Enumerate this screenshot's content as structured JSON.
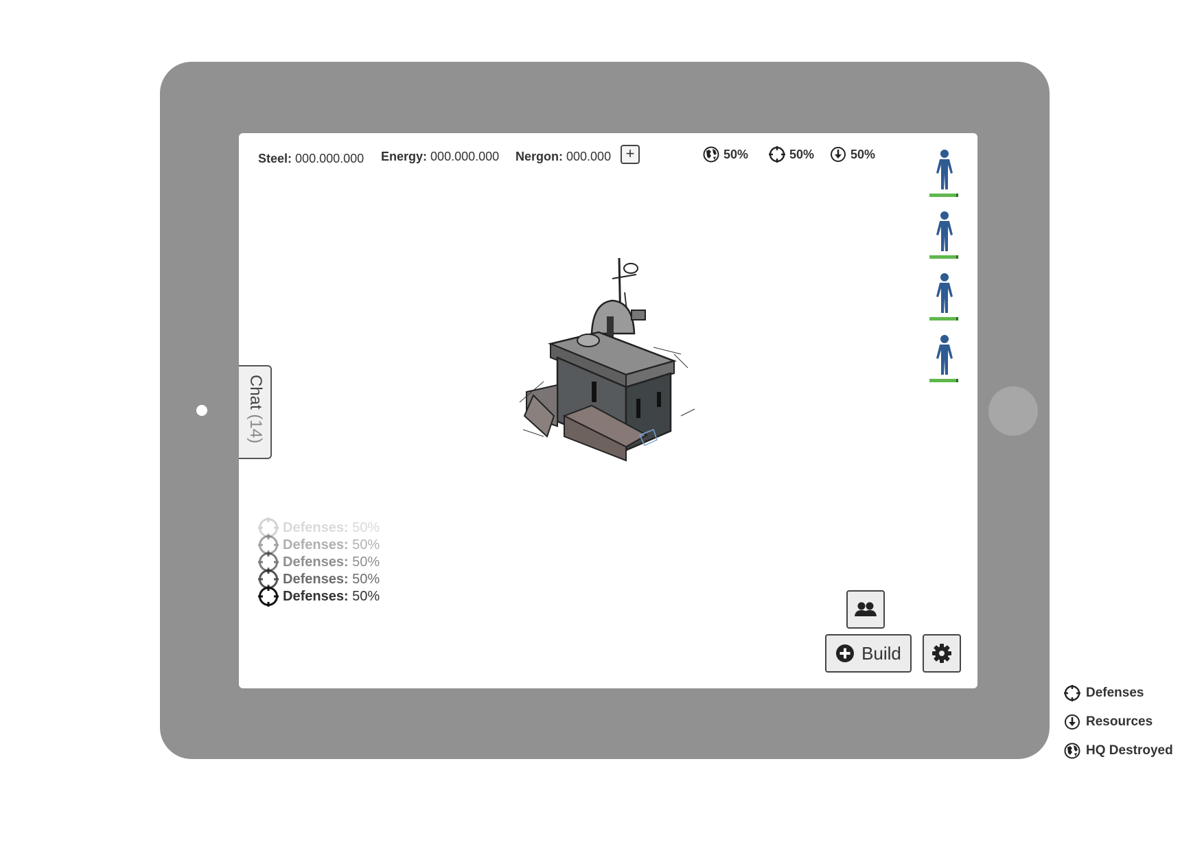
{
  "resources": {
    "steel_label": "Steel:",
    "steel_value": "000.000.000",
    "energy_label": "Energy:",
    "energy_value": "000.000.000",
    "nergon_label": "Nergon:",
    "nergon_value": "000.000",
    "add_label": "+"
  },
  "stats": {
    "hq_destroyed": "50%",
    "defenses": "50%",
    "resources": "50%"
  },
  "players": [
    {
      "icon": "person-icon",
      "health": 1.0
    },
    {
      "icon": "person-icon",
      "health": 1.0
    },
    {
      "icon": "person-icon",
      "health": 1.0
    },
    {
      "icon": "person-icon",
      "health": 1.0
    }
  ],
  "chat": {
    "label": "Chat",
    "count": "(14)"
  },
  "log": [
    {
      "label": "Defenses:",
      "value": "50%"
    },
    {
      "label": "Defenses:",
      "value": "50%"
    },
    {
      "label": "Defenses:",
      "value": "50%"
    },
    {
      "label": "Defenses:",
      "value": "50%"
    },
    {
      "label": "Defenses:",
      "value": "50%"
    }
  ],
  "buttons": {
    "build": "Build"
  },
  "legend": {
    "defenses": "Defenses",
    "resources": "Resources",
    "hq_destroyed": "HQ Destroyed"
  },
  "colors": {
    "device": "#919191",
    "player": "#2f5b93",
    "health": "#5fb84c"
  }
}
